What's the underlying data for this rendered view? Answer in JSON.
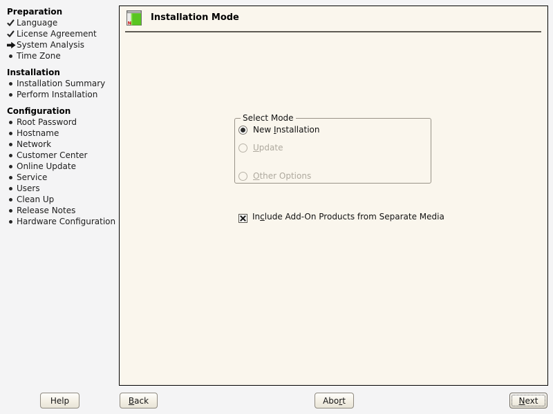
{
  "window": {
    "bg": "#f4f4f5",
    "panel_bg": "#faf6ed",
    "icon_green": "#59c521",
    "icon_red": "#cc1010",
    "disabled_text": "#aea99e"
  },
  "sidebar": {
    "sections": [
      {
        "title": "Preparation",
        "items": [
          {
            "label": "Language",
            "state": "done"
          },
          {
            "label": "License Agreement",
            "state": "done"
          },
          {
            "label": "System Analysis",
            "state": "current"
          },
          {
            "label": "Time Zone",
            "state": "pending"
          }
        ]
      },
      {
        "title": "Installation",
        "items": [
          {
            "label": "Installation Summary",
            "state": "pending"
          },
          {
            "label": "Perform Installation",
            "state": "pending"
          }
        ]
      },
      {
        "title": "Configuration",
        "items": [
          {
            "label": "Root Password",
            "state": "pending"
          },
          {
            "label": "Hostname",
            "state": "pending"
          },
          {
            "label": "Network",
            "state": "pending"
          },
          {
            "label": "Customer Center",
            "state": "pending"
          },
          {
            "label": "Online Update",
            "state": "pending"
          },
          {
            "label": "Service",
            "state": "pending"
          },
          {
            "label": "Users",
            "state": "pending"
          },
          {
            "label": "Clean Up",
            "state": "pending"
          },
          {
            "label": "Release Notes",
            "state": "pending"
          },
          {
            "label": "Hardware Configuration",
            "state": "pending"
          }
        ]
      }
    ]
  },
  "header": {
    "title": "Installation Mode",
    "icon": "package-icon",
    "icon_letter": "N"
  },
  "mode_box": {
    "legend": "Select Mode",
    "options": [
      {
        "pre": "New ",
        "key": "I",
        "post": "nstallation",
        "selected": true,
        "enabled": true
      },
      {
        "pre": "",
        "key": "U",
        "post": "pdate",
        "selected": false,
        "enabled": false
      },
      {
        "pre": "",
        "key": "O",
        "post": "ther Options",
        "selected": false,
        "enabled": false
      }
    ]
  },
  "addon_checkbox": {
    "pre": "In",
    "key": "c",
    "post": "lude Add-On Products from Separate Media",
    "checked": true
  },
  "buttons": {
    "help": {
      "label": "Help"
    },
    "back": {
      "pre": "",
      "key": "B",
      "post": "ack"
    },
    "abort": {
      "pre": "Abo",
      "key": "r",
      "post": "t"
    },
    "next": {
      "pre": "",
      "key": "N",
      "post": "ext",
      "focused": true
    }
  }
}
